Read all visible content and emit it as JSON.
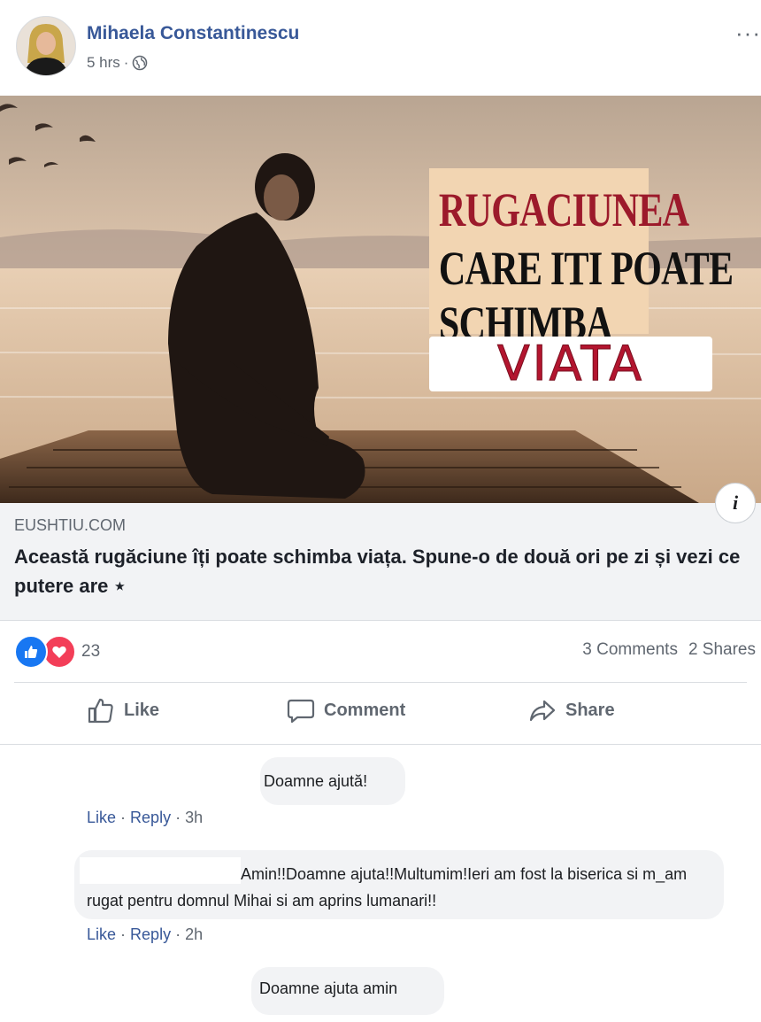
{
  "post": {
    "author": "Mihaela Constantinescu",
    "time": "5 hrs",
    "separator": "·",
    "more": "···",
    "privacy_icon": "globe-icon"
  },
  "image": {
    "title_line1": "RUGACIUNEA",
    "title_line2": "CARE ITI POATE",
    "title_line3": "SCHIMBA",
    "title_line4": "VIATA",
    "info_label": "i",
    "accent_color": "#9c1a2b"
  },
  "link": {
    "domain": "EUSHTIU.COM",
    "title": "Această rugăciune îți poate schimba viața. Spune-o de două ori pe zi și vezi ce putere are ⋆"
  },
  "stats": {
    "reaction_count": "23",
    "comments": "3 Comments",
    "shares": "2 Shares"
  },
  "actions": {
    "like": "Like",
    "comment": "Comment",
    "share": "Share"
  },
  "comments": [
    {
      "text": "Doamne ajută!",
      "like": "Like",
      "reply": "Reply",
      "time": "3h"
    },
    {
      "text": "Amin!!Doamne ajuta!!Multumim!Ieri am fost la biserica si m_am rugat pentru domnul Mihai si am aprins lumanari!!",
      "like": "Like",
      "reply": "Reply",
      "time": "2h"
    },
    {
      "text": "Doamne ajuta amin"
    }
  ]
}
